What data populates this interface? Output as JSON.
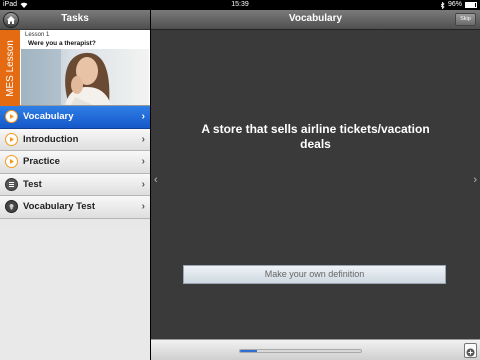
{
  "status_bar": {
    "device": "iPad",
    "time": "15:39",
    "battery": "96%"
  },
  "left_panel": {
    "title": "Tasks",
    "lesson": {
      "tab_label": "MES Lesson",
      "number": "Lesson 1",
      "title": "Were you a therapist?"
    },
    "menu": [
      {
        "label": "Vocabulary",
        "icon": "play-icon",
        "active": true
      },
      {
        "label": "Introduction",
        "icon": "play-icon",
        "active": false
      },
      {
        "label": "Practice",
        "icon": "play-icon",
        "active": false
      },
      {
        "label": "Test",
        "icon": "list-icon",
        "active": false
      },
      {
        "label": "Vocabulary Test",
        "icon": "badge-icon",
        "active": false
      }
    ]
  },
  "main_panel": {
    "title": "Vocabulary",
    "skip_label": "Skip",
    "definition": "A store that sells airline tickets/vacation deals",
    "own_definition_label": "Make your own definition",
    "progress": 0.14
  },
  "colors": {
    "accent_blue": "#1a63d6",
    "lesson_orange": "#e46b12",
    "icon_orange": "#f39a1e"
  }
}
